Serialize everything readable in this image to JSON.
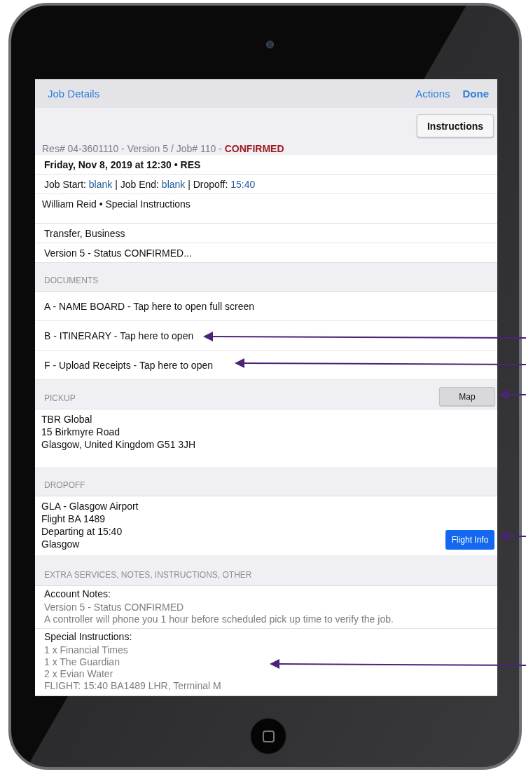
{
  "nav": {
    "title": "Job Details",
    "actions": [
      {
        "label": "Actions",
        "kind": "plain"
      },
      {
        "label": "Done",
        "kind": "primary"
      }
    ]
  },
  "instructions_button": "Instructions",
  "reference": {
    "text": "Res# 04-3601110 - Version 5 / Job# 110 -",
    "status": "CONFIRMED"
  },
  "summary": [
    {
      "kind": "date",
      "text": "Friday, Nov 8, 2019 at 12:30 • RES"
    },
    {
      "kind": "times",
      "parts": [
        {
          "label": "Job Start:",
          "value": "blank"
        },
        {
          "label": "| Job End:",
          "value": "blank"
        },
        {
          "label": "| Dropoff:",
          "value": "15:40"
        }
      ]
    },
    {
      "kind": "tall",
      "text": "William Reid  • Special Instructions"
    },
    {
      "kind": "plain",
      "text": "Transfer, Business"
    },
    {
      "kind": "plain",
      "text": "Version 5 - Status CONFIRMED..."
    }
  ],
  "documents": {
    "header": "DOCUMENTS",
    "items": [
      "A - NAME BOARD - Tap here to open full screen",
      "B - ITINERARY - Tap here to open",
      "F - Upload Receipts - Tap here to open"
    ]
  },
  "pickup": {
    "header": "PICKUP",
    "button": "Map",
    "lines": [
      "TBR Global",
      "15 Birkmyre Road",
      "Glasgow, United Kingdom G51 3JH"
    ]
  },
  "dropoff": {
    "header": "DROPOFF",
    "button": "Flight Info",
    "lines": [
      "GLA - Glasgow Airport",
      "Flight BA 1489",
      "Departing at 15:40",
      "Glasgow"
    ]
  },
  "extras": {
    "header": "EXTRA SERVICES, NOTES, INSTRUCTIONS, OTHER",
    "blocks": [
      {
        "title": "Account Notes:",
        "lines": [
          "Version 5 - Status CONFIRMED",
          "A controller will phone you 1 hour before scheduled pick up time to verify the job."
        ]
      },
      {
        "title": "Special Instructions:",
        "lines": [
          "1 x Financial Times",
          "1 x The Guardian",
          "2 x Evian Water",
          "FLIGHT: 15:40 BA1489 LHR, Terminal M"
        ]
      }
    ]
  }
}
